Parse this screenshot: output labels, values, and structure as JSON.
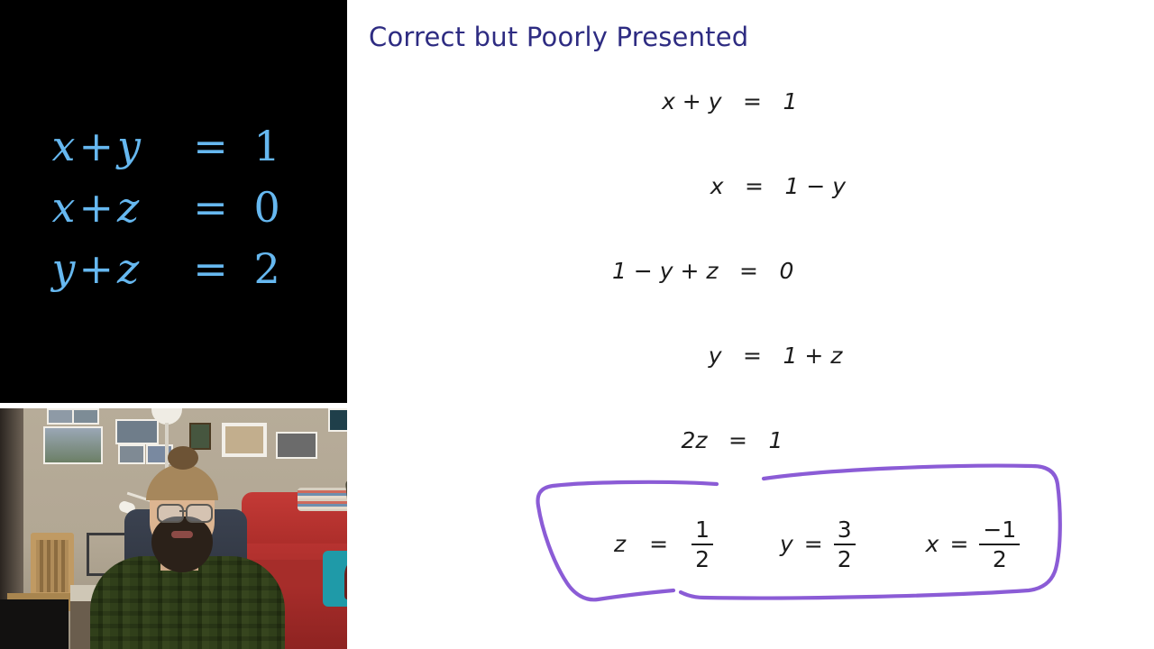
{
  "slide": {
    "title": "Correct but Poorly Presented",
    "title_color": "#2E2C82",
    "background": "#FFFFFF",
    "text_color": "#1C1C1C",
    "equations": [
      {
        "lhs": "x + y",
        "rel": "=",
        "rhs": "1"
      },
      {
        "lhs": "x",
        "rel": "=",
        "rhs": "1 − y"
      },
      {
        "lhs": "1 − y + z",
        "rel": "=",
        "rhs": "0"
      },
      {
        "lhs": "y",
        "rel": "=",
        "rhs": "1 + z"
      },
      {
        "lhs": "2z",
        "rel": "=",
        "rhs": "1"
      }
    ],
    "results": [
      {
        "var": "z",
        "rel": "=",
        "numerator": "1",
        "denominator": "2"
      },
      {
        "var": "y",
        "rel": "=",
        "numerator": "3",
        "denominator": "2"
      },
      {
        "var": "x",
        "rel": "=",
        "numerator": "−1",
        "denominator": "2"
      }
    ],
    "annotation": {
      "shape": "hand-drawn-circle",
      "color": "#8B5CD6",
      "stroke_width": 4
    }
  },
  "share_panel": {
    "background": "#000000",
    "text_color": "#66B8F0",
    "system": [
      {
        "lhs_left": "x",
        "lhs_op": "+",
        "lhs_right": "y",
        "rel": "=",
        "rhs": "1"
      },
      {
        "lhs_left": "x",
        "lhs_op": "+",
        "lhs_right": "z",
        "rel": "=",
        "rhs": "0"
      },
      {
        "lhs_left": "y",
        "lhs_op": "+",
        "lhs_right": "z",
        "rel": "=",
        "rhs": "2"
      }
    ]
  },
  "webcam": {
    "label": "webcam-video-feed"
  }
}
